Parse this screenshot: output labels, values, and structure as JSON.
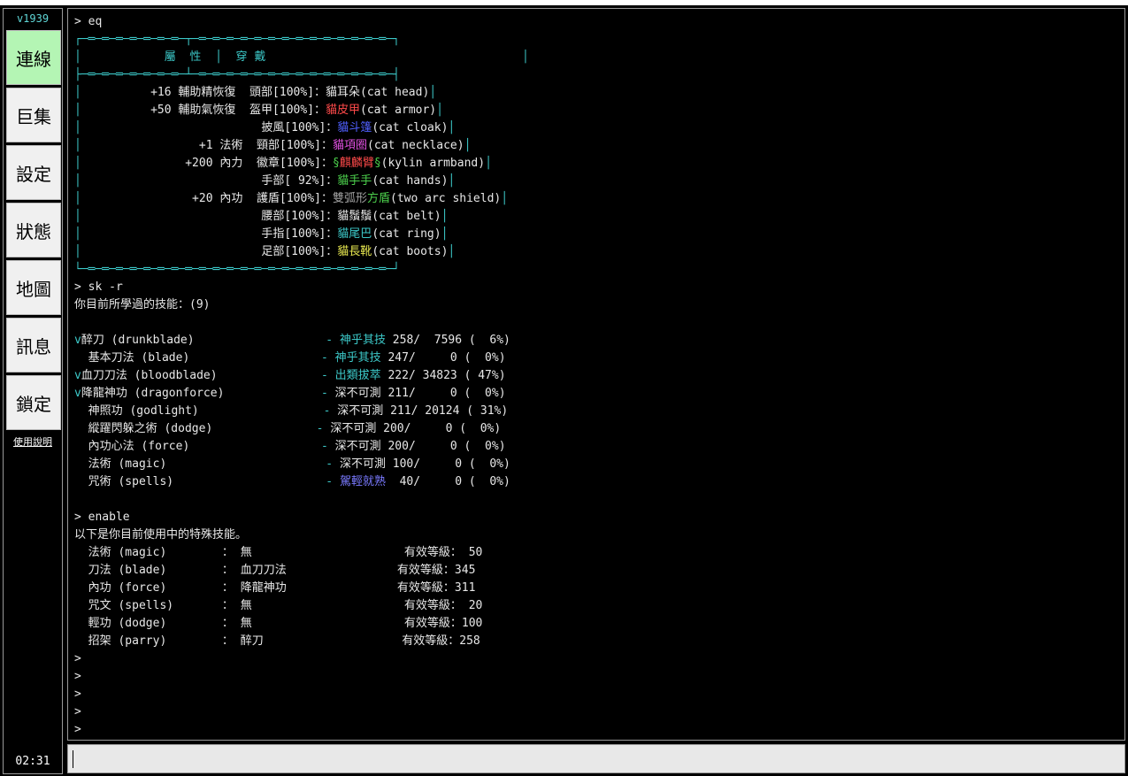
{
  "sidebar": {
    "version": "v1939",
    "nav": [
      "連線",
      "巨集",
      "設定",
      "狀態",
      "地圖",
      "訊息",
      "鎖定"
    ],
    "help_link": "使用說明",
    "clock": "02:31"
  },
  "colors": {
    "active_nav": "#b4f5b4",
    "cyan": "#3cc8c8",
    "red": "#ff4a4a",
    "blue": "#5060ff",
    "magenta": "#e050e0",
    "green": "#4cd04c",
    "yellow": "#e8e850"
  },
  "terminal": {
    "lines": [
      [
        {
          "t": "> eq"
        }
      ],
      [
        {
          "t": "┌─═─═─═─═─═─═─═─┬─═─═─═─═─═─═─═─═─═─═─═─═─═─═─┐",
          "c": "cy"
        }
      ],
      [
        {
          "t": "│",
          "c": "cy"
        },
        {
          "t": "            屬  性  ",
          "c": "cy"
        },
        {
          "t": "│",
          "c": "cy"
        },
        {
          "t": "  穿 戴",
          "c": "cy"
        },
        {
          "t": "                                     │",
          "c": "cy"
        }
      ],
      [
        {
          "t": "├─═─═─═─═─═─═─═─┴─═─═─═─═─═─═─═─═─═─═─═─═─═─═─┤",
          "c": "cy"
        }
      ],
      [
        {
          "t": "│",
          "c": "cy"
        },
        {
          "t": "          +16 輔助精恢復  頭部[100%]：貓耳朵(cat head)"
        },
        {
          "t": "│",
          "c": "cy"
        }
      ],
      [
        {
          "t": "│",
          "c": "cy"
        },
        {
          "t": "          +50 輔助氣恢復  盔甲[100%]："
        },
        {
          "t": "貓皮甲",
          "c": "rd"
        },
        {
          "t": "(cat armor)"
        },
        {
          "t": "│",
          "c": "cy"
        }
      ],
      [
        {
          "t": "│",
          "c": "cy"
        },
        {
          "t": "                          披風[100%]："
        },
        {
          "t": "貓",
          "c": "bl"
        },
        {
          "t": "斗篷",
          "c": "bl"
        },
        {
          "t": "(cat cloak)"
        },
        {
          "t": "│",
          "c": "cy"
        }
      ],
      [
        {
          "t": "│",
          "c": "cy"
        },
        {
          "t": "                 +1 法術  頸部[100%]："
        },
        {
          "t": "貓項圈",
          "c": "mg"
        },
        {
          "t": "(cat necklace)"
        },
        {
          "t": "│",
          "c": "cy"
        }
      ],
      [
        {
          "t": "│",
          "c": "cy"
        },
        {
          "t": "               +200 內力  徽章[100%]："
        },
        {
          "t": "§",
          "c": "gr"
        },
        {
          "t": "麒麟臂",
          "c": "rd"
        },
        {
          "t": "§",
          "c": "gr"
        },
        {
          "t": "(kylin armband)"
        },
        {
          "t": "│",
          "c": "cy"
        }
      ],
      [
        {
          "t": "│",
          "c": "cy"
        },
        {
          "t": "                          手部[ 92%]："
        },
        {
          "t": "貓手手",
          "c": "gr"
        },
        {
          "t": "(cat hands)"
        },
        {
          "t": "│",
          "c": "cy"
        }
      ],
      [
        {
          "t": "│",
          "c": "cy"
        },
        {
          "t": "                +20 內功  護盾[100%]："
        },
        {
          "t": "雙弧形",
          "c": "gy"
        },
        {
          "t": "方盾",
          "c": "gr"
        },
        {
          "t": "(two arc shield)"
        },
        {
          "t": "│",
          "c": "cy"
        }
      ],
      [
        {
          "t": "│",
          "c": "cy"
        },
        {
          "t": "                          腰部[100%]：貓鬚鬚(cat belt)"
        },
        {
          "t": "│",
          "c": "cy"
        }
      ],
      [
        {
          "t": "│",
          "c": "cy"
        },
        {
          "t": "                          手指[100%]："
        },
        {
          "t": "貓尾巴",
          "c": "cy"
        },
        {
          "t": "(cat ring)"
        },
        {
          "t": "│",
          "c": "cy"
        }
      ],
      [
        {
          "t": "│",
          "c": "cy"
        },
        {
          "t": "                          足部[100%]："
        },
        {
          "t": "貓長靴",
          "c": "yl"
        },
        {
          "t": "(cat boots)"
        },
        {
          "t": "│",
          "c": "cy"
        }
      ],
      [
        {
          "t": "└─═─═─═─═─═─═─═─═─═─═─═─═─═─═─═─═─═─═─═─═─═─═─┘",
          "c": "cy"
        }
      ],
      [
        {
          "t": "> sk -r"
        }
      ],
      [
        {
          "t": "你目前所學過的技能：(9)"
        }
      ],
      [
        {
          "t": ""
        }
      ],
      [
        {
          "t": "v",
          "c": "cy"
        },
        {
          "t": "醉刀 (drunkblade)                   "
        },
        {
          "t": "- ",
          "c": "cy"
        },
        {
          "t": "神乎其技",
          "c": "cy"
        },
        {
          "t": " 258/  7596 (  6%)"
        }
      ],
      [
        {
          "t": "  基本刀法 (blade)                   "
        },
        {
          "t": "- ",
          "c": "cy"
        },
        {
          "t": "神乎其技",
          "c": "cy"
        },
        {
          "t": " 247/     0 (  0%)"
        }
      ],
      [
        {
          "t": "v",
          "c": "cy"
        },
        {
          "t": "血刀刀法 (bloodblade)               "
        },
        {
          "t": "- ",
          "c": "cy"
        },
        {
          "t": "出類拔萃",
          "c": "cy"
        },
        {
          "t": " 222/ 34823 ( 47%)"
        }
      ],
      [
        {
          "t": "v",
          "c": "cy"
        },
        {
          "t": "降龍神功 (dragonforce)              "
        },
        {
          "t": "- ",
          "c": "cy"
        },
        {
          "t": "深不可測 211/     0 (  0%)"
        }
      ],
      [
        {
          "t": "  神照功 (godlight)                  "
        },
        {
          "t": "- ",
          "c": "cy"
        },
        {
          "t": "深不可測 211/ 20124 ( 31%)"
        }
      ],
      [
        {
          "t": "  縱躍閃躲之術 (dodge)               "
        },
        {
          "t": "- ",
          "c": "cy"
        },
        {
          "t": "深不可測 200/     0 (  0%)"
        }
      ],
      [
        {
          "t": "  內功心法 (force)                   "
        },
        {
          "t": "- ",
          "c": "cy"
        },
        {
          "t": "深不可測 200/     0 (  0%)"
        }
      ],
      [
        {
          "t": "  法術 (magic)                       "
        },
        {
          "t": "- ",
          "c": "cy"
        },
        {
          "t": "深不可測 100/     0 (  0%)"
        }
      ],
      [
        {
          "t": "  咒術 (spells)                      "
        },
        {
          "t": "- ",
          "c": "cy"
        },
        {
          "t": "駕輕就熟",
          "c": "lb"
        },
        {
          "t": "  40/     0 (  0%)"
        }
      ],
      [
        {
          "t": ""
        }
      ],
      [
        {
          "t": "> enable"
        }
      ],
      [
        {
          "t": "以下是你目前使用中的特殊技能。"
        }
      ],
      [
        {
          "t": "  法術 (magic)        ： 無                      有效等級： 50"
        }
      ],
      [
        {
          "t": "  刀法 (blade)        ： 血刀刀法                有效等級：345"
        }
      ],
      [
        {
          "t": "  內功 (force)        ： 降龍神功                有效等級：311"
        }
      ],
      [
        {
          "t": "  咒文 (spells)       ： 無                      有效等級： 20"
        }
      ],
      [
        {
          "t": "  輕功 (dodge)        ： 無                      有效等級：100"
        }
      ],
      [
        {
          "t": "  招架 (parry)        ： 醉刀                    有效等級：258"
        }
      ],
      [
        {
          "t": ">"
        }
      ],
      [
        {
          "t": ">"
        }
      ],
      [
        {
          "t": ">"
        }
      ],
      [
        {
          "t": ">"
        }
      ],
      [
        {
          "t": ">"
        }
      ]
    ]
  },
  "input": {
    "value": ""
  }
}
